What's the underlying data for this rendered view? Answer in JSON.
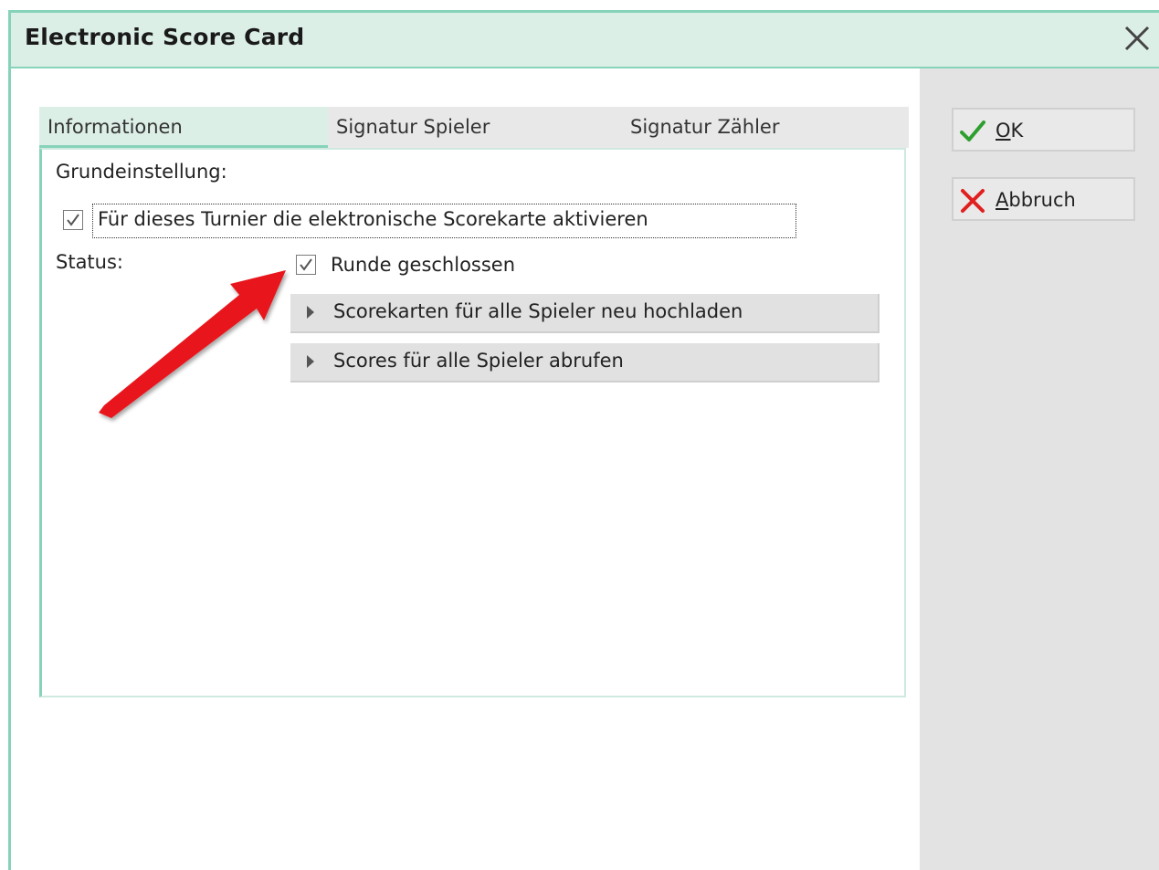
{
  "window": {
    "title": "Electronic Score Card"
  },
  "actions": {
    "ok": {
      "mnemonic": "O",
      "rest": "K"
    },
    "cancel": {
      "mnemonic": "A",
      "rest": "bbruch"
    }
  },
  "tabs": [
    {
      "label": "Informationen",
      "active": true
    },
    {
      "label": "Signatur Spieler",
      "active": false
    },
    {
      "label": "Signatur Zähler",
      "active": false
    }
  ],
  "info": {
    "section_label": "Grundeinstellung:",
    "enable_checkbox": {
      "label": "Für dieses Turnier die elektronische Scorekarte aktivieren",
      "checked": true
    },
    "status_label": "Status:",
    "round_closed_checkbox": {
      "label": "Runde geschlossen",
      "checked": true
    },
    "upload_button": "Scorekarten für alle Spieler neu hochladen",
    "fetch_button": "Scores für alle Spieler abrufen"
  },
  "colors": {
    "accent": "#86d3b9",
    "titlebar_bg": "#dcefe7",
    "ok_icon": "#2e9e2e",
    "cancel_icon": "#e02020",
    "annotation_arrow": "#e8191b"
  },
  "icons": [
    "close-icon",
    "check-icon",
    "x-icon",
    "triangle-right-icon"
  ]
}
